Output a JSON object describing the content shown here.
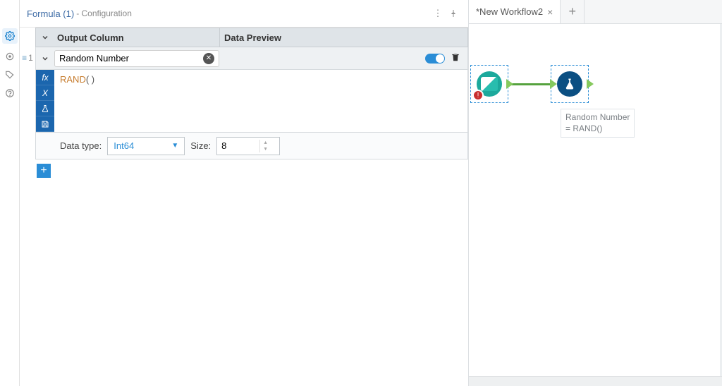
{
  "panel": {
    "title": "Formula (1)",
    "subtitle": " - Configuration"
  },
  "headers": {
    "output_col": "Output Column",
    "data_preview": "Data Preview"
  },
  "formula": {
    "row_number": "1",
    "column_name": "Random Number",
    "expression_fn": "RAND",
    "expression_args": "( )",
    "data_type_label": "Data type:",
    "data_type_value": "Int64",
    "size_label": "Size:",
    "size_value": "8"
  },
  "canvas": {
    "tab_name": "*New Workflow2",
    "node_label_line1": "Random Number",
    "node_label_line2": "= RAND()"
  }
}
